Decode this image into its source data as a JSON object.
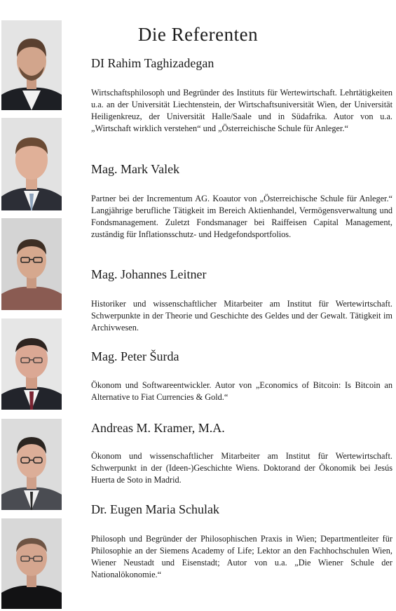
{
  "page": {
    "title": "Die Referenten"
  },
  "speakers": [
    {
      "name": "DI Rahim Taghizadegan",
      "bio": "Wirtschaftsphilosoph und Begründer des Instituts für Wertewirtschaft. Lehrtätigkeiten u.a. an der Universität Liechtenstein, der Wirtschaftsuniversität Wien, der Universität Heiligenkreuz, der Universität Halle/Saale und in Südafrika. Autor von u.a. „Wirtschaft wirklich verstehen“ und „Österreichische Schule für Anleger.“"
    },
    {
      "name": "Mag. Mark Valek",
      "bio": "Partner bei der Incrementum AG. Koautor von „Österreichische Schule für Anleger.“ Langjährige berufliche Tätigkeit im Bereich Aktienhandel, Vermögensverwaltung und Fondsmanagement. Zuletzt Fondsmanager bei Raiffeisen Capital Management, zuständig für Inflationsschutz- und Hedgefondsportfolios."
    },
    {
      "name": "Mag. Johannes Leitner",
      "bio": "Historiker und wissenschaftlicher Mitarbeiter am Institut für Wertewirtschaft. Schwerpunkte in der Theorie und Geschichte des Geldes und der Gewalt. Tätigkeit im Archivwesen."
    },
    {
      "name": "Mag. Peter Šurda",
      "bio": "Ökonom und Softwareentwickler. Autor von „Economics of Bitcoin: Is Bitcoin an Alternative to Fiat Currencies & Gold.“"
    },
    {
      "name": "Andreas M. Kramer, M.A.",
      "bio": "Ökonom und wissenschaftlicher Mitarbeiter am Institut für Wertewirtschaft. Schwerpunkt in der (Ideen-)Geschichte Wiens. Doktorand der Ökonomik bei Jesús Huerta de Soto in Madrid."
    },
    {
      "name": "Dr. Eugen Maria Schulak",
      "bio": "Philosoph und Begründer der Philosophischen Praxis in Wien; Departmentleiter für Philosophie an der Siemens Academy of Life; Lektor an den Fachhochschulen Wien, Wiener Neustadt und Eisenstadt; Autor von u.a. „Die Wiener Schule der Nationalökonomie.“"
    }
  ]
}
